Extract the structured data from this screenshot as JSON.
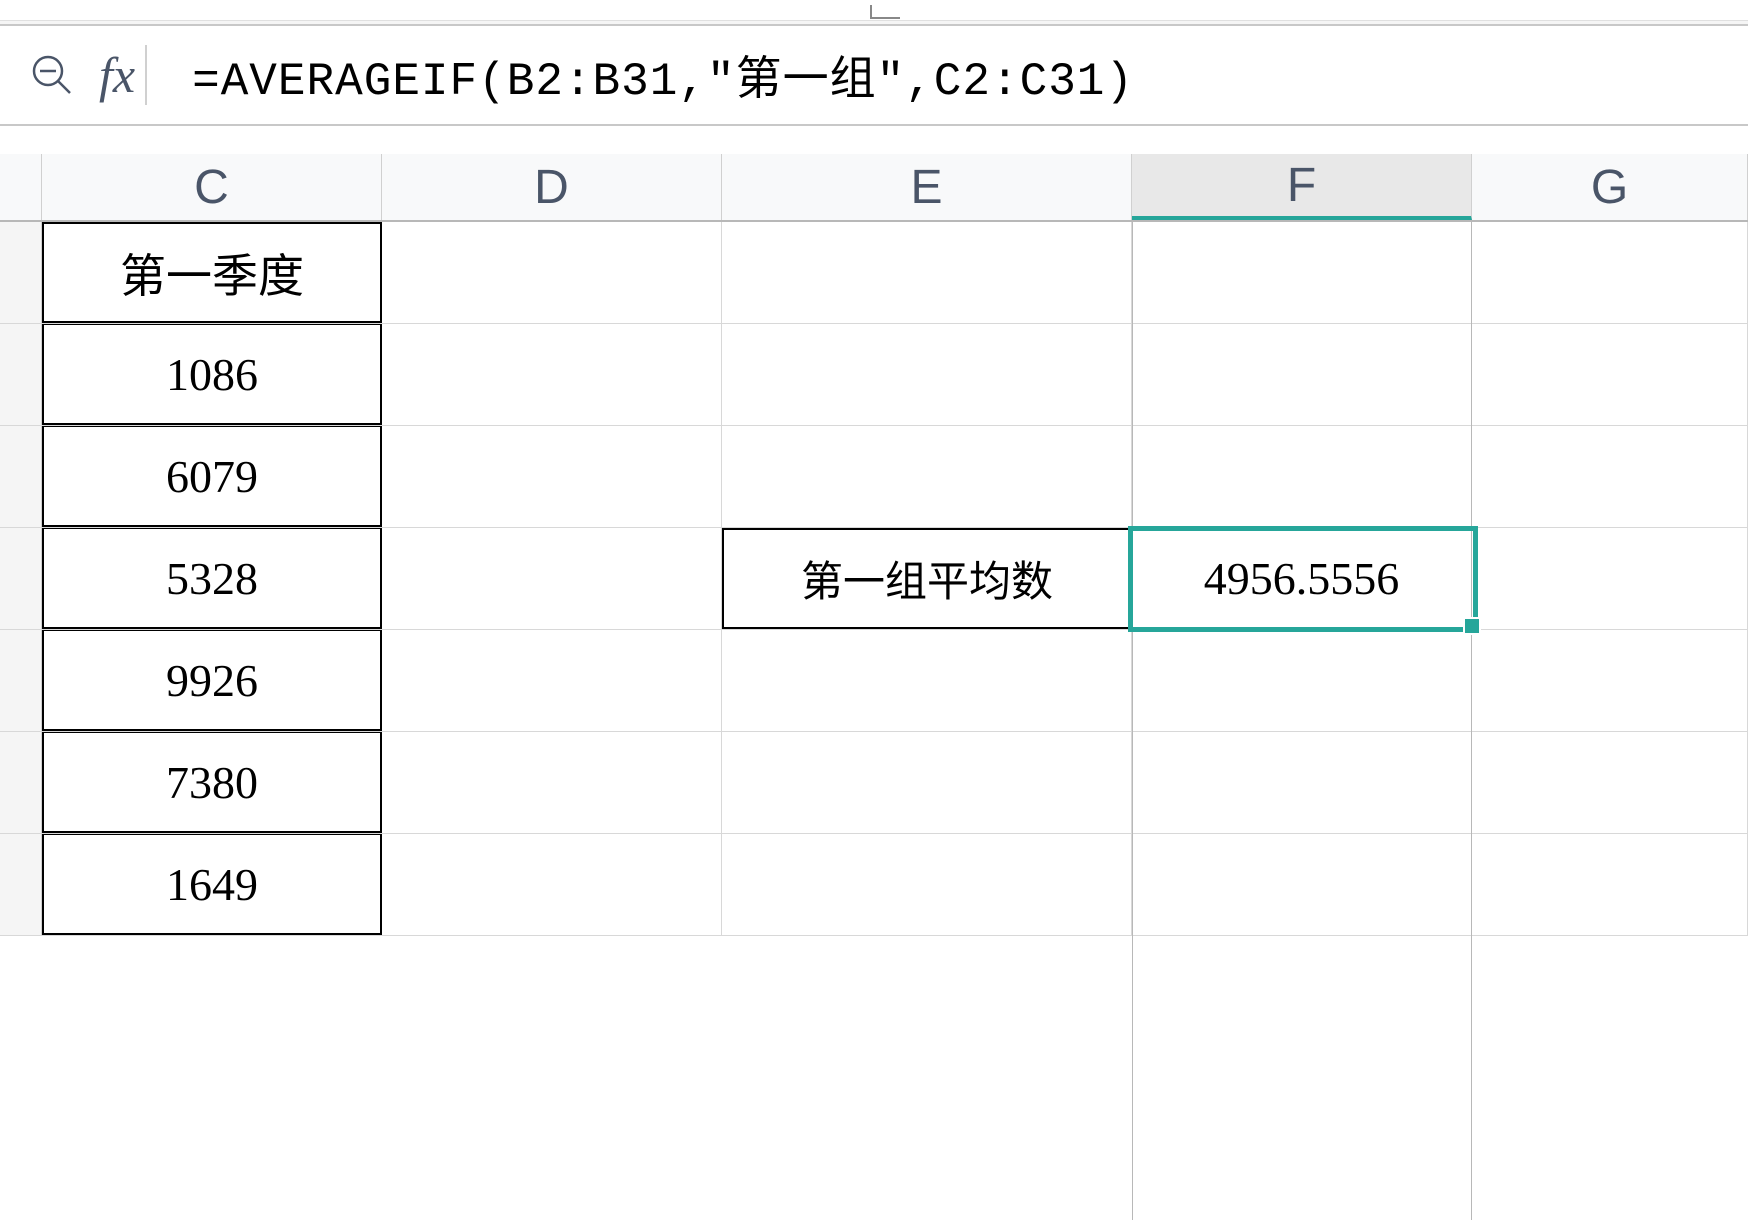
{
  "formulaBar": {
    "formula": "=AVERAGEIF(B2:B31,\"第一组\",C2:C31)"
  },
  "columns": {
    "C": "C",
    "D": "D",
    "E": "E",
    "F": "F",
    "G": "G"
  },
  "columnCData": {
    "header": "第一季度",
    "rows": [
      "1086",
      "6079",
      "5328",
      "9926",
      "7380",
      "1649"
    ]
  },
  "labelCell": {
    "E4": "第一组平均数"
  },
  "resultCell": {
    "F4": "4956.5556"
  },
  "selectedCell": "F4",
  "activeColumn": "F"
}
